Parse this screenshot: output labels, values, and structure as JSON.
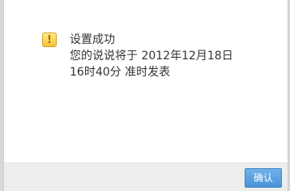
{
  "dialog": {
    "icon": "warning-icon",
    "icon_glyph": "!",
    "title": "设置成功",
    "line2": "您的说说将于 2012年12月18日",
    "line3": "16时40分 准时发表",
    "confirm_label": "确认"
  },
  "colors": {
    "accent": "#4a93d6",
    "icon": "#f5c33b"
  }
}
